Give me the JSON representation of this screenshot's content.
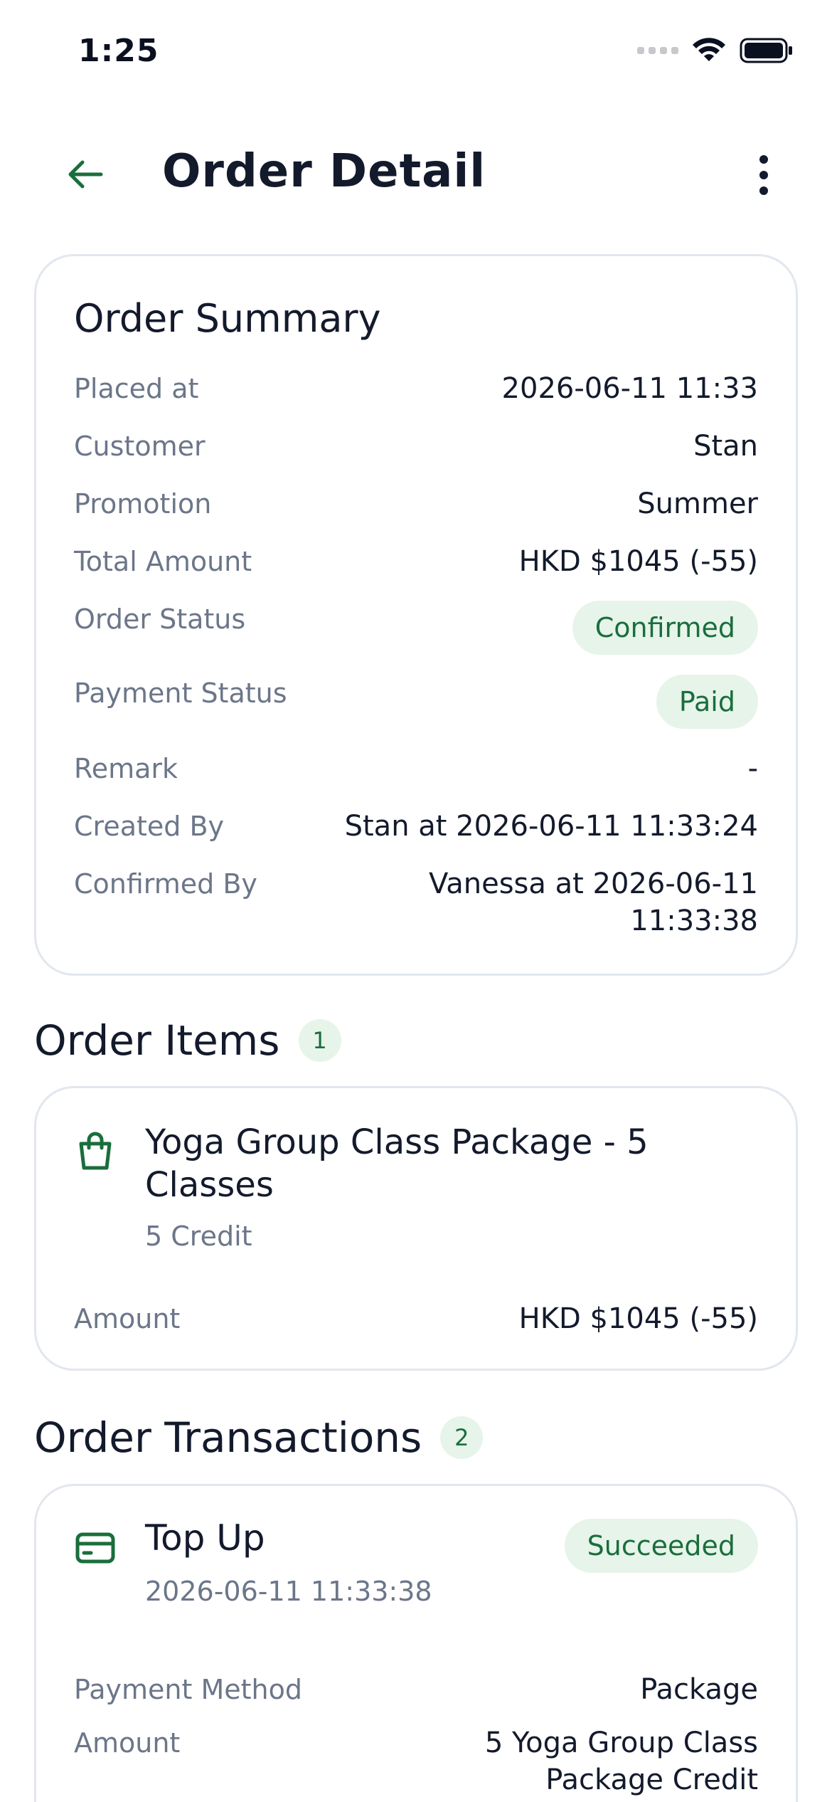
{
  "status_bar": {
    "time": "1:25"
  },
  "header": {
    "title": "Order Detail"
  },
  "summary": {
    "title": "Order Summary",
    "rows": [
      {
        "label": "Placed at",
        "value": "2026-06-11 11:33"
      },
      {
        "label": "Customer",
        "value": "Stan"
      },
      {
        "label": "Promotion",
        "value": "Summer"
      },
      {
        "label": "Total Amount",
        "value": "HKD $1045 (-55)"
      },
      {
        "label": "Order Status",
        "value": "Confirmed"
      },
      {
        "label": "Payment Status",
        "value": "Paid"
      },
      {
        "label": "Remark",
        "value": "-"
      },
      {
        "label": "Created By",
        "value": "Stan at 2026-06-11 11:33:24"
      },
      {
        "label": "Confirmed By",
        "value_line1": "Vanessa at 2026-06-11",
        "value_line2": "11:33:38"
      }
    ]
  },
  "order_items": {
    "heading": "Order Items",
    "count": "1",
    "items": [
      {
        "title": "Yoga Group Class Package - 5 Classes",
        "subtitle": "5 Credit",
        "amount_label": "Amount",
        "amount_value": "HKD $1045 (-55)"
      }
    ]
  },
  "order_transactions": {
    "heading": "Order Transactions",
    "count": "2",
    "items": [
      {
        "title": "Top Up",
        "timestamp": "2026-06-11 11:33:38",
        "status": "Succeeded",
        "payment_method_label": "Payment Method",
        "payment_method_value": "Package",
        "amount_label": "Amount",
        "amount_value_line1": "5 Yoga Group Class",
        "amount_value_line2": "Package Credit"
      }
    ]
  },
  "colors": {
    "accent": "#1a6e3c",
    "badge_bg": "#e6f4ea",
    "label_gray": "#6c7689",
    "text_dark": "#131a2c",
    "card_border": "#e2e7ee"
  }
}
